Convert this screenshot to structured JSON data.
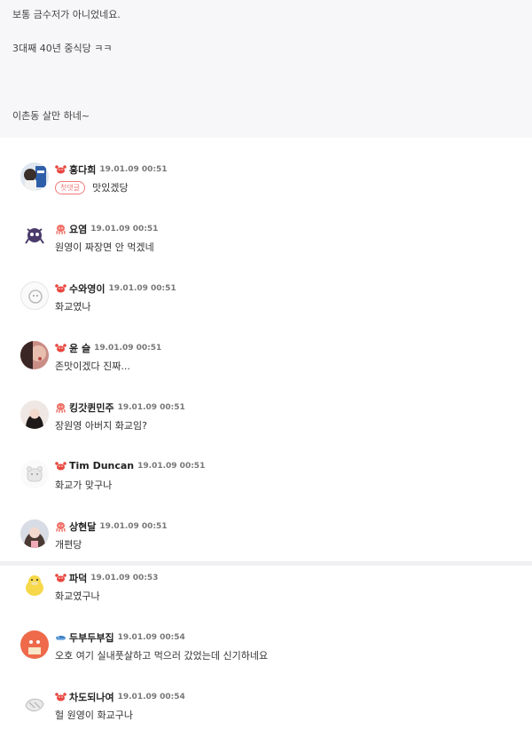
{
  "post": {
    "lines": [
      "보통 금수저가 아니었네요.",
      "3대째 40년 중식당 ㅋㅋ",
      "이촌동 살만 하네~"
    ]
  },
  "first_comment_badge": "첫댓글",
  "comments": [
    {
      "nick": "홍다희",
      "time": "19.01.09 00:51",
      "text": "맛있겠당",
      "level": "crab-icon"
    },
    {
      "nick": "요염",
      "time": "19.01.09 00:51",
      "text": "원영이 짜장면 안 먹겠네",
      "level": "octopus-icon"
    },
    {
      "nick": "수와영이",
      "time": "19.01.09 00:51",
      "text": "화교였나",
      "level": "crab-icon"
    },
    {
      "nick": "윤 슬",
      "time": "19.01.09 00:51",
      "text": "존맛이겠다 진짜...",
      "level": "crab-icon"
    },
    {
      "nick": "킹갓퀸민주",
      "time": "19.01.09 00:51",
      "text": "장원영 아버지 화교임?",
      "level": "octopus-icon"
    },
    {
      "nick": "Tim Duncan",
      "time": "19.01.09 00:51",
      "text": "화교가 맞구나",
      "level": "crab-icon"
    },
    {
      "nick": "상현달",
      "time": "19.01.09 00:51",
      "text": "개편당",
      "level": "octopus-icon"
    },
    {
      "nick": "파덕",
      "time": "19.01.09 00:53",
      "text": "화교였구나",
      "level": "crab-icon"
    },
    {
      "nick": "두부두부집",
      "time": "19.01.09 00:54",
      "text": "오호 여기 실내풋살하고 먹으러 갔었는데 신기하네요",
      "level": "whale-icon"
    },
    {
      "nick": "차도되나여",
      "time": "19.01.09 00:54",
      "text": "헐 원영이 화교구나",
      "level": "crab-icon"
    }
  ],
  "colors": {
    "crab": "#e8473f",
    "octopus": "#f0736a",
    "whale": "#3b7fc4",
    "badge": "#f07a7a"
  }
}
